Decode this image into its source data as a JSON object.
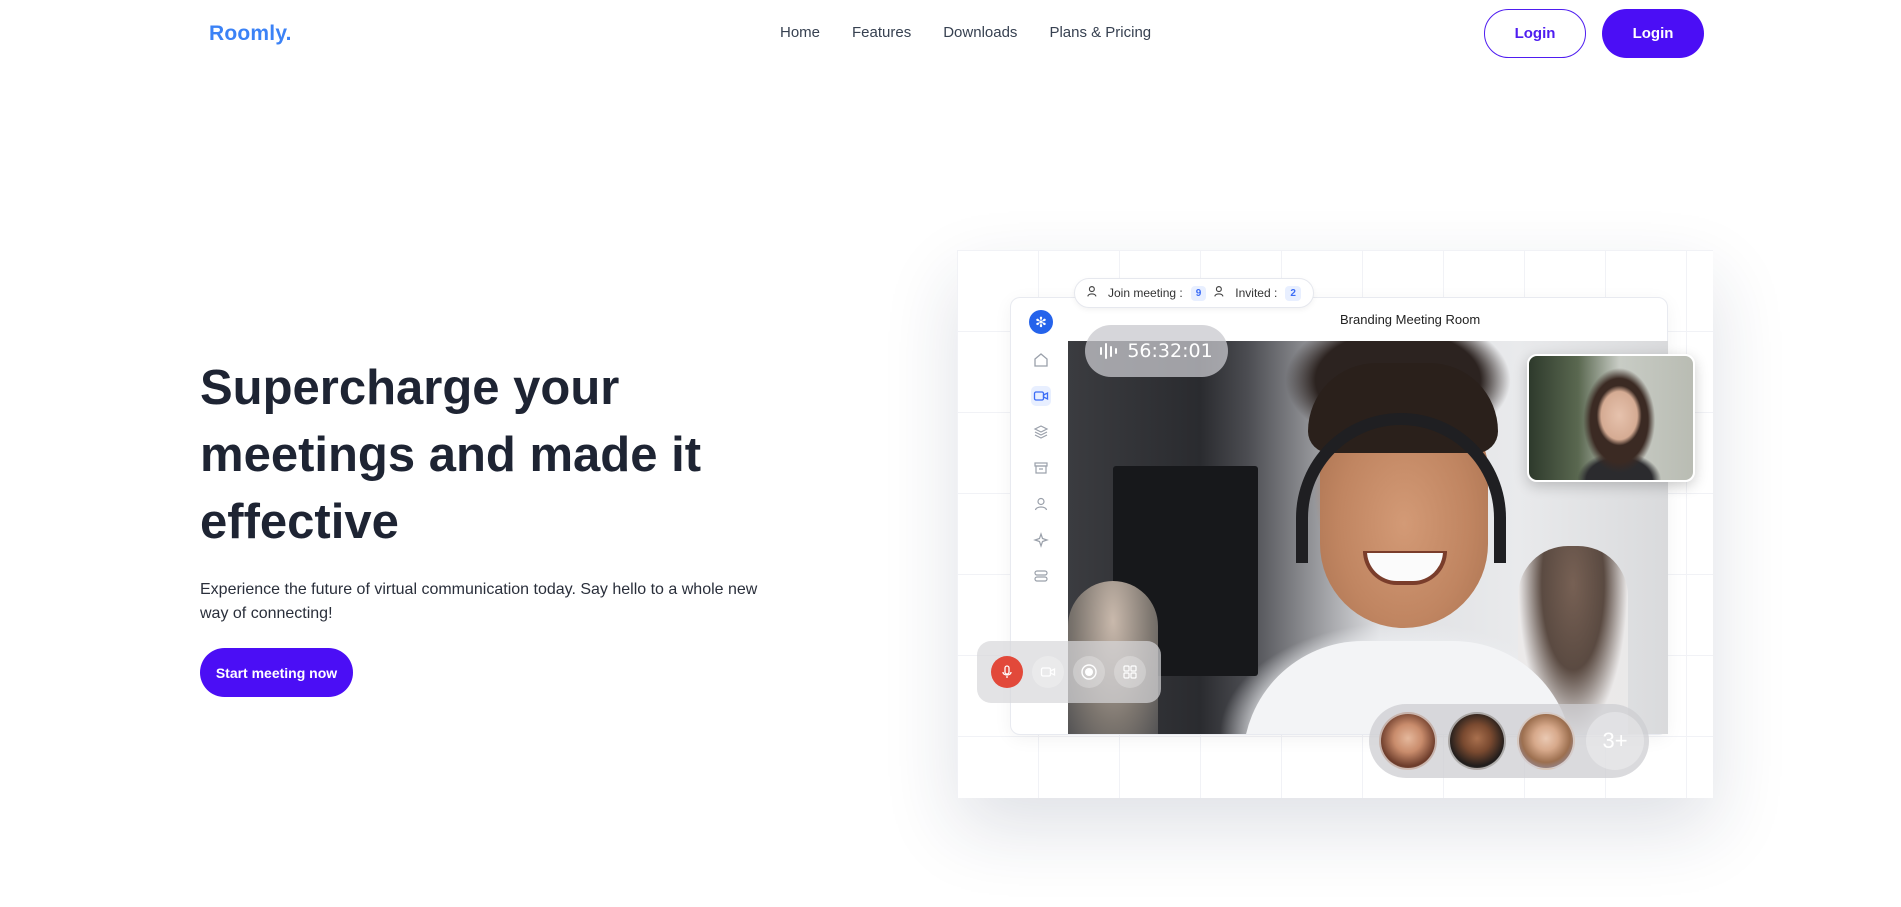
{
  "nav": {
    "logo": "Roomly.",
    "links": [
      "Home",
      "Features",
      "Downloads",
      "Plans & Pricing"
    ],
    "login_outline": "Login",
    "login_solid": "Login"
  },
  "hero": {
    "title": "Supercharge your meetings and made it effective",
    "subtitle": "Experience the future of virtual communication today. Say hello to a whole new way of connecting!",
    "cta": "Start meeting now"
  },
  "mockup": {
    "join_label": "Join meeting :",
    "join_count": "9",
    "invited_label": "Invited :",
    "invited_count": "2",
    "room_title": "Branding Meeting Room",
    "timer": "56:32:01",
    "more_attendees": "3+",
    "sidebar_icons": [
      "home-icon",
      "video-icon",
      "layers-icon",
      "archive-icon",
      "user-icon",
      "sparkle-icon",
      "settings-icon"
    ],
    "controls": [
      "mic-icon",
      "camera-icon",
      "record-icon",
      "grid-icon"
    ]
  },
  "colors": {
    "brand_logo": "#3b82f6",
    "primary": "#4b0ef5",
    "mic_active": "#e2493a"
  }
}
